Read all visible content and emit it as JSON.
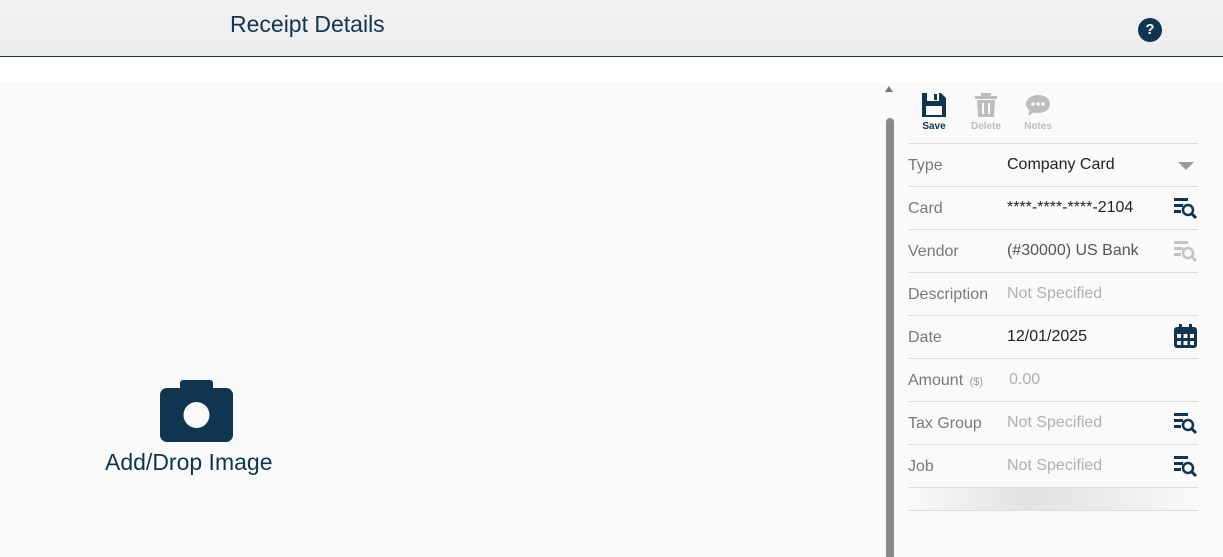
{
  "header": {
    "title": "Receipt Details",
    "help_label": "?"
  },
  "drop_zone": {
    "label": "Add/Drop Image",
    "icon": "camera-icon"
  },
  "toolbar": {
    "save": "Save",
    "delete": "Delete",
    "notes": "Notes"
  },
  "colors": {
    "brand": "#0f3550",
    "disabled": "#bdbdbd",
    "label": "#7a7a7a",
    "placeholder": "#b0b0b0"
  },
  "form": {
    "type": {
      "label": "Type",
      "value": "Company Card"
    },
    "card": {
      "label": "Card",
      "value": "****-****-****-2104"
    },
    "vendor": {
      "label": "Vendor",
      "value": "(#30000) US Bank"
    },
    "description": {
      "label": "Description",
      "value": "Not Specified"
    },
    "date": {
      "label": "Date",
      "value": "12/01/2025"
    },
    "amount": {
      "label": "Amount",
      "unit": "($)",
      "value": "0.00"
    },
    "tax_group": {
      "label": "Tax Group",
      "value": "Not Specified"
    },
    "job": {
      "label": "Job",
      "value": "Not Specified"
    }
  }
}
